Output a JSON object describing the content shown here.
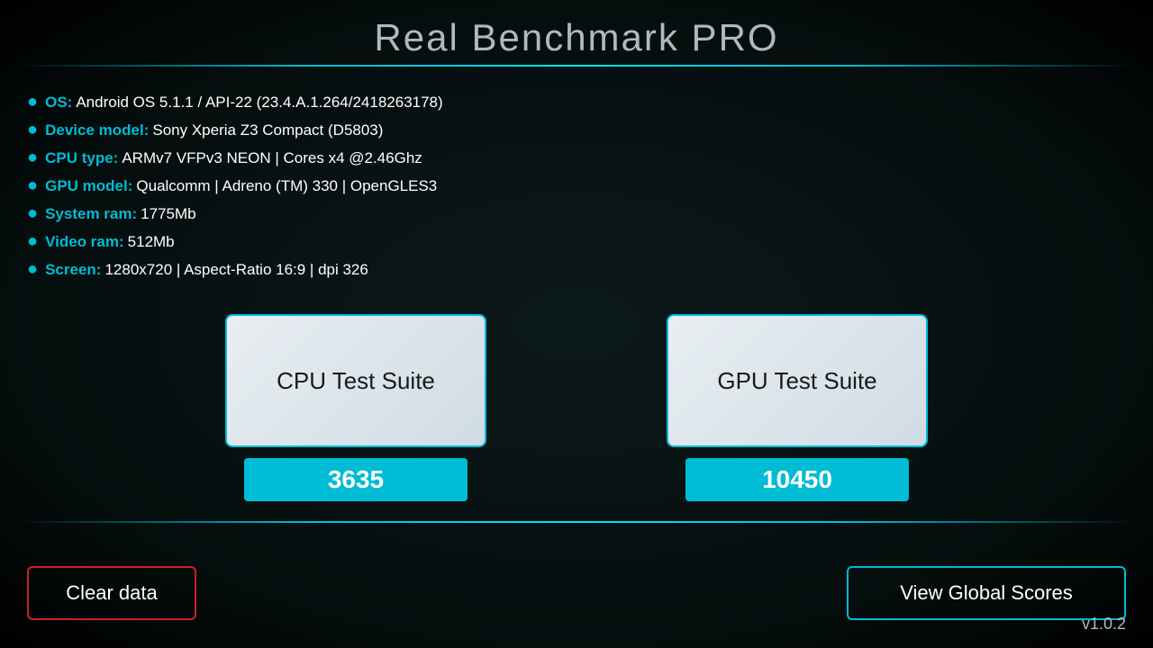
{
  "app": {
    "title": "Real Benchmark PRO",
    "version": "v1.0.2"
  },
  "device_info": {
    "os_label": "OS:",
    "os_value": " Android OS 5.1.1 / API-22 (23.4.A.1.264/2418263178)",
    "device_model_label": "Device model:",
    "device_model_value": " Sony Xperia Z3 Compact (D5803)",
    "cpu_type_label": "CPU type:",
    "cpu_type_value": " ARMv7 VFPv3 NEON | Cores x4 @2.46Ghz",
    "gpu_model_label": "GPU model:",
    "gpu_model_value": " Qualcomm | Adreno (TM) 330 | OpenGLES3",
    "system_ram_label": "System ram:",
    "system_ram_value": " 1775Mb",
    "video_ram_label": "Video ram:",
    "video_ram_value": " 512Mb",
    "screen_label": "Screen:",
    "screen_value": " 1280x720 | Aspect-Ratio 16:9 | dpi 326"
  },
  "cards": {
    "cpu": {
      "label": "CPU Test Suite",
      "score": "3635"
    },
    "gpu": {
      "label": "GPU Test Suite",
      "score": "10450"
    }
  },
  "buttons": {
    "clear_data": "Clear data",
    "view_global_scores": "View Global Scores"
  }
}
